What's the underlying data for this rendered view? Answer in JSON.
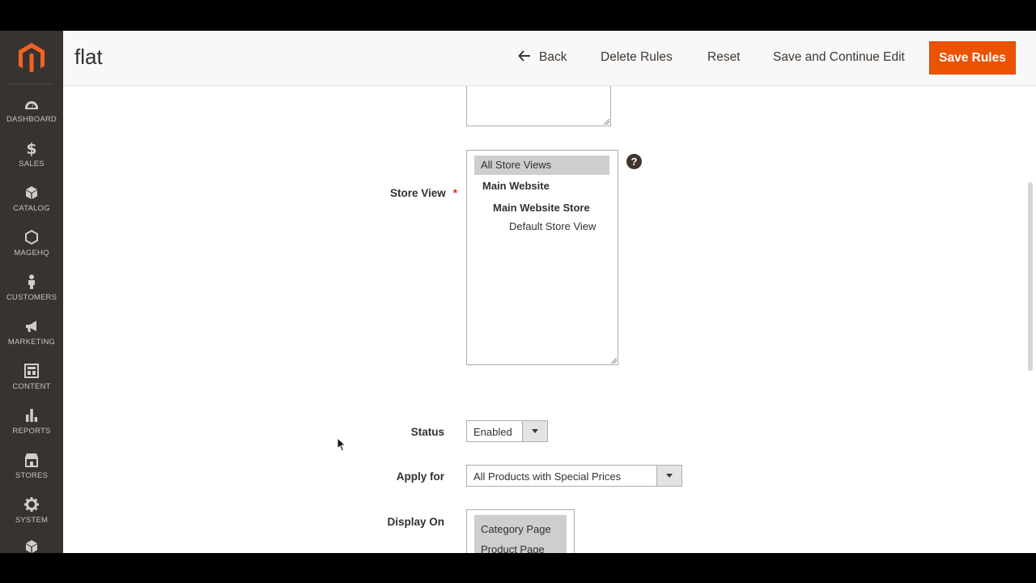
{
  "sidebar": {
    "items": [
      {
        "label": "DASHBOARD",
        "icon": "dashboard-icon"
      },
      {
        "label": "SALES",
        "icon": "dollar-icon"
      },
      {
        "label": "CATALOG",
        "icon": "cube-icon"
      },
      {
        "label": "MAGEHQ",
        "icon": "hexagon-icon"
      },
      {
        "label": "CUSTOMERS",
        "icon": "person-icon"
      },
      {
        "label": "MARKETING",
        "icon": "megaphone-icon"
      },
      {
        "label": "CONTENT",
        "icon": "layout-icon"
      },
      {
        "label": "REPORTS",
        "icon": "bar-chart-icon"
      },
      {
        "label": "STORES",
        "icon": "storefront-icon"
      },
      {
        "label": "SYSTEM",
        "icon": "gear-icon"
      }
    ]
  },
  "header": {
    "title": "flat",
    "back_label": "Back",
    "delete_label": "Delete Rules",
    "reset_label": "Reset",
    "save_continue_label": "Save and Continue Edit",
    "save_label": "Save Rules"
  },
  "form": {
    "store_view": {
      "label": "Store View",
      "required_mark": "*",
      "options": [
        "All Store Views",
        "Main Website",
        "Main Website Store",
        "Default Store View"
      ],
      "selected": "All Store Views",
      "help": "?"
    },
    "status": {
      "label": "Status",
      "value": "Enabled"
    },
    "apply_for": {
      "label": "Apply for",
      "value": "All Products with Special Prices"
    },
    "display_on": {
      "label": "Display On",
      "options": [
        "Category Page",
        "Product Page"
      ],
      "selected": [
        "Category Page",
        "Product Page"
      ]
    }
  },
  "colors": {
    "sidebar_bg": "#373330",
    "accent": "#eb5202",
    "logo": "#f26322",
    "selected_option": "#cecece"
  }
}
